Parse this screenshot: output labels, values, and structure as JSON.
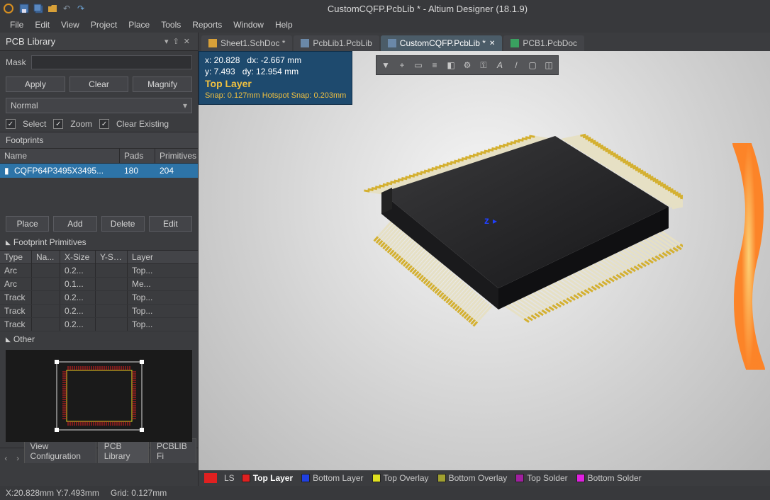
{
  "app": {
    "title": "CustomCQFP.PcbLib * - Altium Designer (18.1.9)"
  },
  "menubar": [
    "File",
    "Edit",
    "View",
    "Project",
    "Place",
    "Tools",
    "Reports",
    "Window",
    "Help"
  ],
  "panel": {
    "title": "PCB Library",
    "mask_label": "Mask",
    "buttons": {
      "apply": "Apply",
      "clear": "Clear",
      "magnify": "Magnify"
    },
    "mode": "Normal",
    "checks": {
      "select": "Select",
      "zoom": "Zoom",
      "clear_existing": "Clear Existing"
    },
    "footprints": {
      "header_label": "Footprints",
      "columns": {
        "name": "Name",
        "pads": "Pads",
        "primitives": "Primitives"
      },
      "rows": [
        {
          "name": "CQFP64P3495X3495...",
          "pads": "180",
          "primitives": "204"
        }
      ],
      "buttons": {
        "place": "Place",
        "add": "Add",
        "delete": "Delete",
        "edit": "Edit"
      }
    },
    "primitives": {
      "title": "Footprint Primitives",
      "columns": {
        "type": "Type",
        "name": "Na...",
        "xsize": "X-Size",
        "ysize": "Y-Size",
        "layer": "Layer"
      },
      "rows": [
        {
          "type": "Arc",
          "name": "",
          "xsize": "0.2...",
          "ysize": "",
          "layer": "Top..."
        },
        {
          "type": "Arc",
          "name": "",
          "xsize": "0.1...",
          "ysize": "",
          "layer": "Me..."
        },
        {
          "type": "Track",
          "name": "",
          "xsize": "0.2...",
          "ysize": "",
          "layer": "Top..."
        },
        {
          "type": "Track",
          "name": "",
          "xsize": "0.2...",
          "ysize": "",
          "layer": "Top..."
        },
        {
          "type": "Track",
          "name": "",
          "xsize": "0.2...",
          "ysize": "",
          "layer": "Top..."
        }
      ]
    },
    "other_label": "Other",
    "footer_tabs": {
      "view_conf": "View Configuration",
      "pcb_lib": "PCB Library",
      "pcblib_fi": "PCBLIB Fi"
    }
  },
  "tabs": [
    {
      "label": "Sheet1.SchDoc *",
      "active": false,
      "color": "#d8a038"
    },
    {
      "label": "PcbLib1.PcbLib",
      "active": false,
      "color": "#6a88a8"
    },
    {
      "label": "CustomCQFP.PcbLib *",
      "active": true,
      "color": "#6a88a8"
    },
    {
      "label": "PCB1.PcbDoc",
      "active": false,
      "color": "#3aa060"
    }
  ],
  "hud": {
    "x": "x: 20.828",
    "dx": "dx: -2.667  mm",
    "y": "y:  7.493",
    "dy": "dy: 12.954  mm",
    "layer": "Top Layer",
    "snap": "Snap: 0.127mm Hotspot Snap: 0.203mm"
  },
  "axis_label": "z",
  "layer_bar": {
    "ls": "LS",
    "items": [
      {
        "label": "Top Layer",
        "color": "#e02020",
        "selected": true
      },
      {
        "label": "Bottom Layer",
        "color": "#2040e0"
      },
      {
        "label": "Top Overlay",
        "color": "#e0e020"
      },
      {
        "label": "Bottom Overlay",
        "color": "#a0a030"
      },
      {
        "label": "Top Solder",
        "color": "#a020a0"
      },
      {
        "label": "Bottom Solder",
        "color": "#e020e0"
      }
    ]
  },
  "status": {
    "coords": "X:20.828mm Y:7.493mm",
    "grid": "Grid: 0.127mm"
  }
}
